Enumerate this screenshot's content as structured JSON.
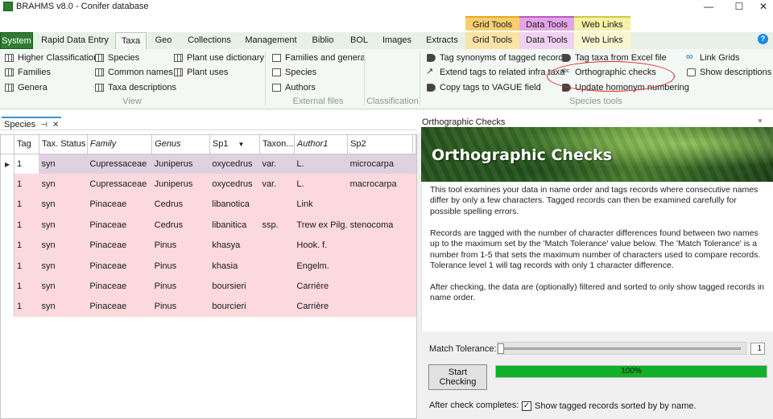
{
  "window": {
    "title": "BRAHMS v8.0 - Conifer database",
    "min": "—",
    "max": "☐",
    "close": "✕"
  },
  "context_tabs": [
    "Grid Tools",
    "Data Tools",
    "Web Links"
  ],
  "ribbon_tabs": [
    "System",
    "Rapid Data Entry",
    "Taxa",
    "Geo",
    "Collections",
    "Management",
    "Biblio",
    "BOL",
    "Images",
    "Extracts",
    "Grid Tools",
    "Data Tools",
    "Web Links"
  ],
  "help": "?",
  "ribbon": {
    "view": {
      "label": "View",
      "items": [
        "Higher Classification",
        "Families",
        "Genera",
        "Species",
        "Common names",
        "Taxa descriptions",
        "Plant use dictionary",
        "Plant uses"
      ]
    },
    "external": {
      "label": "External files",
      "items": [
        "Families and genera",
        "Species",
        "Authors"
      ]
    },
    "classification": {
      "label": "Classification"
    },
    "species_tools": {
      "label": "Species tools",
      "items": [
        "Tag synonyms of tagged records",
        "Extend tags to related infra taxa",
        "Copy tags to VAGUE field",
        "Tag taxa from Excel file",
        "Orthographic checks",
        "Update homonym numbering",
        "Link Grids",
        "Show descriptions"
      ]
    }
  },
  "left_pane": {
    "tab_label": "Species",
    "pin": "⊣",
    "close": "✕",
    "columns": [
      "Tag",
      "Tax. Status",
      "Family",
      "Genus",
      "Sp1",
      "Taxon...",
      "Author1",
      "Sp2"
    ],
    "rows": [
      [
        "1",
        "syn",
        "Cupressaceae",
        "Juniperus",
        "oxycedrus",
        "var.",
        "L.",
        "microcarpa"
      ],
      [
        "1",
        "syn",
        "Cupressaceae",
        "Juniperus",
        "oxycedrus",
        "var.",
        "L.",
        "macrocarpa"
      ],
      [
        "1",
        "syn",
        "Pinaceae",
        "Cedrus",
        "libanotica",
        "",
        "Link",
        ""
      ],
      [
        "1",
        "syn",
        "Pinaceae",
        "Cedrus",
        "libanitica",
        "ssp.",
        "Trew ex Pilg.",
        "stenocoma"
      ],
      [
        "1",
        "syn",
        "Pinaceae",
        "Pinus",
        "khasya",
        "",
        "Hook. f.",
        ""
      ],
      [
        "1",
        "syn",
        "Pinaceae",
        "Pinus",
        "khasia",
        "",
        "Engelm.",
        ""
      ],
      [
        "1",
        "syn",
        "Pinaceae",
        "Pinus",
        "boursieri",
        "",
        "Carrière",
        ""
      ],
      [
        "1",
        "syn",
        "Pinaceae",
        "Pinus",
        "bourcieri",
        "",
        "Carrière",
        ""
      ]
    ],
    "row_colors": {
      "tagged": "#fbd9dc",
      "selected": "#dfd1df"
    }
  },
  "right_pane": {
    "header": "Orthographic Checks",
    "banner_title": "Orthographic Checks",
    "p1": "This tool examines your data in name order and tags records where consecutive names differ by only a few characters. Tagged records can then be examined carefully for possible spelling errors.",
    "p2": "Records are tagged with the number of character differences found between two names up to the maximum set by the 'Match Tolerance' value below. The 'Match Tolerance' is a number from 1-5 that sets the maximum number of characters used to compare records. Tolerance level 1 will tag records with only 1 character difference.",
    "p3": "After checking, the data are (optionally) filtered and sorted to only show tagged records in name order.",
    "match_tolerance_label": "Match Tolerance:",
    "match_tolerance_value": "1",
    "start_button": "Start Checking",
    "progress_text": "100%",
    "progress_value": 1.0,
    "after_label": "After check completes:",
    "checkbox_checked": true,
    "checkbox_label": "Show tagged records sorted by by name."
  },
  "colors": {
    "system_tab": "#2e7d32",
    "progress": "#10b02a",
    "highlight": "#e02020"
  }
}
